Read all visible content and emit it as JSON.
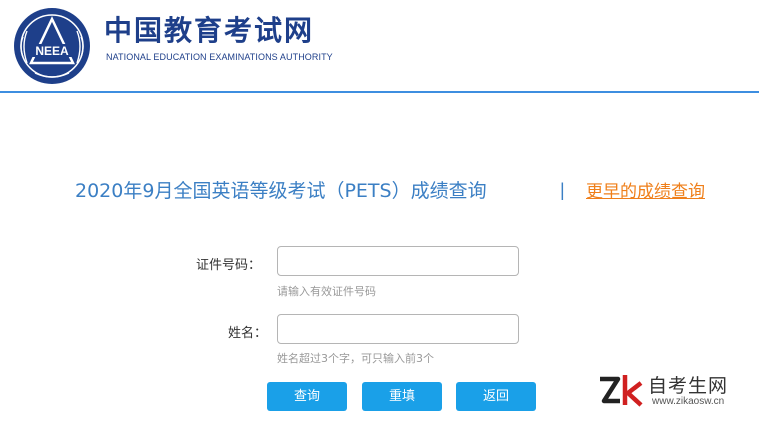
{
  "header": {
    "logo_emblem_text": "NEEA",
    "logo_title": "中国教育考试网",
    "logo_subtitle": "NATIONAL EDUCATION EXAMINATIONS AUTHORITY"
  },
  "main": {
    "title": "2020年9月全国英语等级考试（PETS）成绩查询",
    "separator": "|",
    "earlier_link": "更早的成绩查询"
  },
  "form": {
    "id_label": "证件号码：",
    "id_value": "",
    "id_hint": "请输入有效证件号码",
    "name_label": "姓名：",
    "name_value": "",
    "name_hint": "姓名超过3个字，可只输入前3个"
  },
  "buttons": {
    "query": "查询",
    "reset": "重填",
    "back": "返回"
  },
  "watermark": {
    "title": "自考生网",
    "url": "www.zikaosw.cn"
  },
  "colors": {
    "brand_navy": "#1e3f8a",
    "title_blue": "#3b7fc4",
    "link_orange": "#ef7f1a",
    "button_blue": "#1aa0e8",
    "header_rule": "#3d8ee0"
  }
}
